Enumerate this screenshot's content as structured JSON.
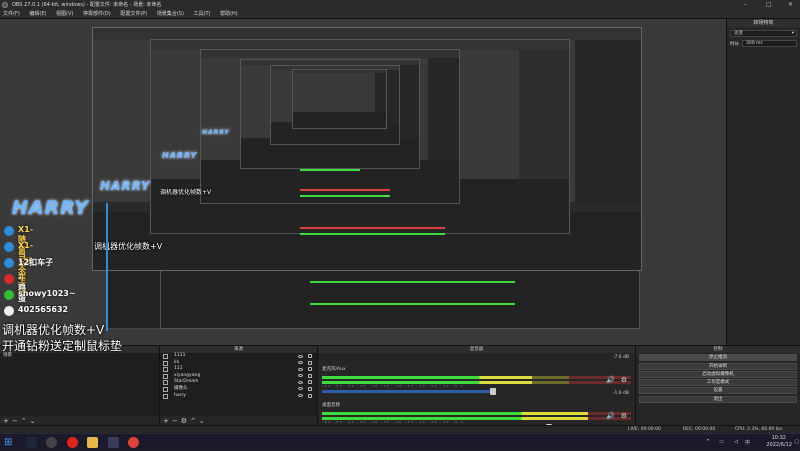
{
  "window": {
    "title": "OBS 27.0.1 (64-bit, windows) - 配置文件: 未命名 - 场景: 未命名",
    "minimize": "–",
    "maximize": "□",
    "close": "✕"
  },
  "menu": [
    "文件(F)",
    "编辑(E)",
    "视图(V)",
    "停靠部件(D)",
    "配置文件(P)",
    "场景集合(S)",
    "工具(T)",
    "帮助(H)"
  ],
  "transition_panel": {
    "header": "转场特效",
    "transition_value": "淡变",
    "duration_label": "时长",
    "duration_value": "300 ms"
  },
  "overlay": {
    "line1": "调机器优化帧数+V",
    "line2": "开通钻粉送定制鼠标垫",
    "logo": "HARRY",
    "social": [
      {
        "icon": "weibo-icon",
        "text": "X1-随意+状态卡位"
      },
      {
        "icon": "weibo-icon",
        "text": "X1-当天车位"
      },
      {
        "icon": "weibo-icon",
        "text": "12扣车子"
      },
      {
        "icon": "douyin-icon",
        "text": "-鸡蛋"
      },
      {
        "icon": "wechat-icon",
        "text": "snowy1023~"
      },
      {
        "icon": "qq-icon",
        "text": "402565632"
      }
    ]
  },
  "docks": {
    "scenes": {
      "header": "场景",
      "items": [
        "场景"
      ]
    },
    "sources": {
      "header": "来源",
      "items": [
        "1111",
        "kk",
        "111",
        "xiyangyang",
        "StarDream",
        "摄像头",
        "harry"
      ]
    },
    "mixer": {
      "header": "混音器",
      "channels": [
        {
          "name": "麦克风/Aux",
          "db": "-7.6 dB",
          "level": 0.68,
          "fader": 0.68
        },
        {
          "name": "桌面音频",
          "db": "-1.6 dB",
          "level": 0.86,
          "fader": 0.86
        }
      ],
      "ticks": "-60 -55 -50 -45 -40 -35 -30 -25 -20 -15 -10 -5 0"
    },
    "controls": {
      "header": "控制",
      "buttons": [
        "停止推流",
        "开始录制",
        "启动虚拟摄像机",
        "工作室模式",
        "设置",
        "退出"
      ]
    }
  },
  "statusbar": {
    "live": "LIVE: 00:00:00",
    "rec": "REC: 00:00:00",
    "cpu": "CPU: 2.3%, 60.00 fps"
  },
  "tray": {
    "time": "10:32",
    "date": "2022/6/12",
    "lang": "中"
  },
  "colors": {
    "accent_blue": "#2a5ea6",
    "meter_green": "#3ddc3d",
    "logo_blue": "#6fb8ff"
  }
}
